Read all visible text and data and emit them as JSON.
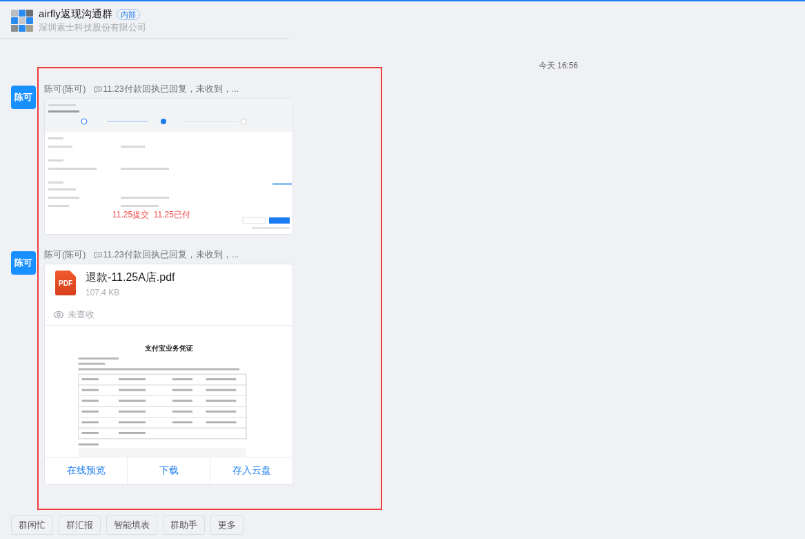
{
  "header": {
    "title": "airfly返现沟通群",
    "tag": "内部",
    "subtitle": "深圳素士科技股份有限公司"
  },
  "timestamp": "今天 16:56",
  "messages": [
    {
      "avatar": "陈可",
      "sender": "陈可(陈可)",
      "quote": "11.23付款回执已回复，未收到，...",
      "image": {
        "kind": "picture",
        "note": "11.25提交  11.25已付"
      }
    },
    {
      "kind": "file",
      "avatar": "陈可",
      "sender": "陈可(陈可)",
      "quote": "11.23付款回执已回复，未收到，...",
      "file": {
        "type_label": "PDF",
        "name": "退款-11.25A店.pdf",
        "size": "107.4 KB",
        "status": "未查收",
        "preview": {
          "kind": "picture",
          "title": "支付宝业务凭证"
        },
        "actions": [
          "在线预览",
          "下载",
          "存入云盘"
        ]
      }
    }
  ],
  "toolbar": [
    "群闲忙",
    "群汇报",
    "智能填表",
    "群助手",
    "更多"
  ]
}
